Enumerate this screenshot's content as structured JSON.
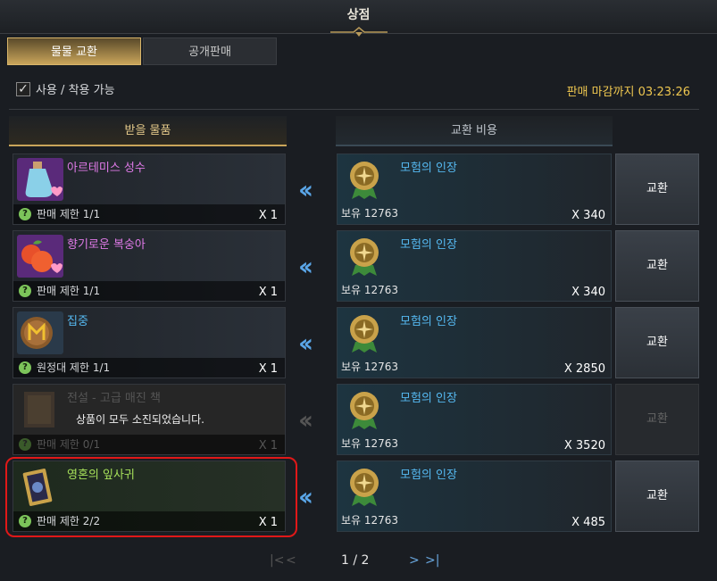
{
  "window": {
    "title": "상점"
  },
  "tabs": [
    {
      "label": "물물 교환",
      "active": true
    },
    {
      "label": "공개판매",
      "active": false
    }
  ],
  "filter": {
    "checked": true,
    "label": "사용 / 착용 가능"
  },
  "deadline": "판매 마감까지 03:23:26",
  "columns": {
    "receive": "받을 물품",
    "cost": "교환 비용"
  },
  "rows": [
    {
      "item_name": "아르테미스 성수",
      "name_color": "#e07ae8",
      "limit": "판매 제한 1/1",
      "qty": "X 1",
      "cost_name": "모험의 인장",
      "own": "보유 12763",
      "price": "X 340",
      "button": "교환",
      "icon": "potion-icon"
    },
    {
      "item_name": "향기로운 복숭아",
      "name_color": "#e07ae8",
      "limit": "판매 제한 1/1",
      "qty": "X 1",
      "cost_name": "모험의 인장",
      "own": "보유 12763",
      "price": "X 340",
      "button": "교환",
      "icon": "peach-icon"
    },
    {
      "item_name": "집중",
      "name_color": "#55b8f0",
      "limit": "원정대 제한 1/1",
      "qty": "X 1",
      "cost_name": "모험의 인장",
      "own": "보유 12763",
      "price": "X 2850",
      "button": "교환",
      "icon": "rune-icon"
    },
    {
      "item_name": "전설 - 고급 매진 책",
      "name_color": "#555555",
      "limit": "판매 제한 0/1",
      "qty": "X 1",
      "cost_name": "모험의 인장",
      "own": "보유 12763",
      "price": "X 3520",
      "button": "교환",
      "icon": "book-icon",
      "soldout": "상품이 모두 소진되었습니다."
    },
    {
      "item_name": "영혼의 잎사귀",
      "name_color": "#a6e05a",
      "limit": "판매 제한 2/2",
      "qty": "X 1",
      "cost_name": "모험의 인장",
      "own": "보유 12763",
      "price": "X 485",
      "button": "교환",
      "icon": "card-icon"
    }
  ],
  "pager": {
    "first": "|<",
    "prev": "<",
    "page": "1 / 2",
    "next": ">",
    "last": ">|"
  }
}
